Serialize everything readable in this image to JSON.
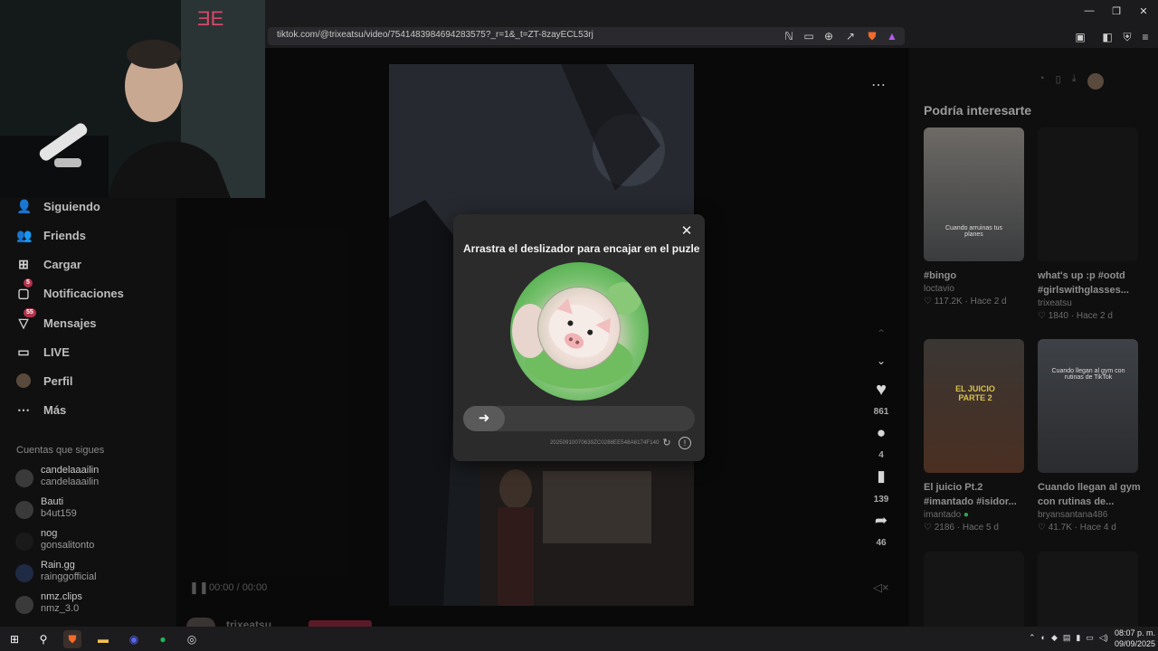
{
  "browser": {
    "url": "tiktok.com/@trixeatsu/video/7541483984694283575?_r=1&_t=ZT-8zayECL53rj"
  },
  "sidebar": {
    "items": [
      {
        "label": "Siguiendo",
        "icon": "following-icon"
      },
      {
        "label": "Friends",
        "icon": "friends-icon"
      },
      {
        "label": "Cargar",
        "icon": "upload-icon"
      },
      {
        "label": "Notificaciones",
        "icon": "bell-icon",
        "badge": "5"
      },
      {
        "label": "Mensajes",
        "icon": "message-icon",
        "badge": "55"
      },
      {
        "label": "LIVE",
        "icon": "live-icon"
      },
      {
        "label": "Perfil",
        "icon": "profile-avatar"
      },
      {
        "label": "Más",
        "icon": "more-icon"
      }
    ],
    "following_title": "Cuentas que sigues",
    "following": [
      {
        "name": "candelaaailin",
        "handle": "candelaaailin"
      },
      {
        "name": "Bauti",
        "handle": "b4ut159"
      },
      {
        "name": "nog",
        "handle": "gonsalitonto"
      },
      {
        "name": "Rain.gg",
        "handle": "rainggofficial"
      },
      {
        "name": "nmz.clips",
        "handle": "nmz_3.0"
      }
    ]
  },
  "player": {
    "time": "00:00 / 00:00",
    "author_partial": "trixeatsu"
  },
  "actions": {
    "likes": "861",
    "comments": "4",
    "saves": "139",
    "shares": "46"
  },
  "captcha": {
    "title": "Arrastra el deslizador para encajar en el puzle",
    "id_text": "20250910070639ZC0288EE548A6174F140"
  },
  "recommendations": {
    "title": "Podría interesarte",
    "cards": [
      {
        "title": "#bingo",
        "author": "loctavio",
        "likes": "117.2K",
        "age": "Hace 2 d",
        "thumb_text": "Cuando arruinas tus planes"
      },
      {
        "title": "what's up :p #ootd #girlswithglasses...",
        "author": "trixeatsu",
        "likes": "1840",
        "age": "Hace 2 d",
        "thumb_text": ""
      },
      {
        "title": "El juicio Pt.2 #imantado #isidor...",
        "author": "imantado",
        "likes": "2186",
        "age": "Hace 5 d",
        "thumb_text": "EL JUICIO PARTE 2"
      },
      {
        "title": "Cuando llegan al gym con rutinas de...",
        "author": "bryansantana486",
        "likes": "41.7K",
        "age": "Hace 4 d",
        "thumb_text": "Cuando llegan al gym con rutinas de TikTok"
      }
    ]
  },
  "taskbar": {
    "time": "08:07 p. m.",
    "date": "09/09/2025"
  },
  "colors": {
    "badge": "#b2334b",
    "puzzle_green": "#4fae4a"
  }
}
